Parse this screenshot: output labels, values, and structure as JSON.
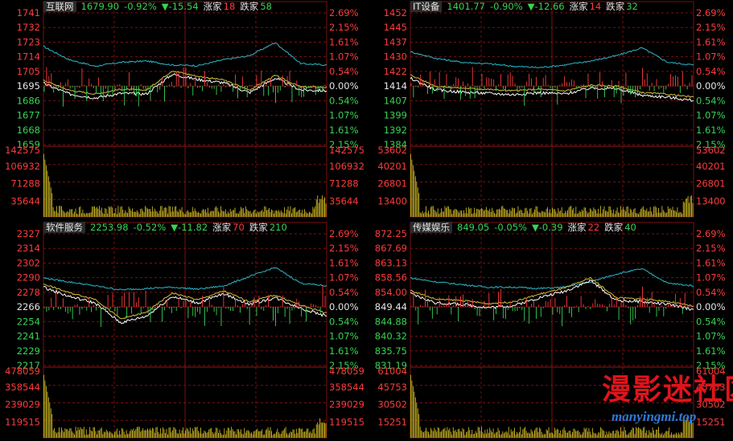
{
  "panels": [
    {
      "name": "互联网",
      "price": "1679.90",
      "pct_change": "-0.92%",
      "change": "▼-15.54",
      "up_label": "涨家",
      "up_count": "18",
      "down_label": "跌家",
      "down_count": "58",
      "price_ticks": [
        "1741",
        "1732",
        "1723",
        "1714",
        "1705",
        "1695",
        "1686",
        "1677",
        "1668",
        "1659"
      ],
      "pct_ticks": [
        "2.69%",
        "2.15%",
        "1.61%",
        "1.07%",
        "0.54%",
        "0.00%",
        "0.54%",
        "1.07%",
        "1.61%",
        "2.15%"
      ],
      "volume_ticks": [
        "142575",
        "106932",
        "71288",
        "35644"
      ]
    },
    {
      "name": "IT设备",
      "price": "1401.77",
      "pct_change": "-0.90%",
      "change": "▼-12.66",
      "up_label": "涨家",
      "up_count": "14",
      "down_label": "跌家",
      "down_count": "32",
      "price_ticks": [
        "1452",
        "1445",
        "1437",
        "1430",
        "1422",
        "1414",
        "1407",
        "1399",
        "1392",
        "1384"
      ],
      "pct_ticks": [
        "2.69%",
        "2.15%",
        "1.61%",
        "1.07%",
        "0.54%",
        "0.00%",
        "0.54%",
        "1.07%",
        "1.61%",
        "2.15%"
      ],
      "volume_ticks": [
        "53602",
        "40201",
        "26801",
        "13400"
      ]
    },
    {
      "name": "软件服务",
      "price": "2253.98",
      "pct_change": "-0.52%",
      "change": "▼-11.82",
      "up_label": "涨家",
      "up_count": "70",
      "down_label": "跌家",
      "down_count": "210",
      "price_ticks": [
        "2327",
        "2314",
        "2302",
        "2290",
        "2278",
        "2266",
        "2254",
        "2241",
        "2229",
        "2217"
      ],
      "pct_ticks": [
        "2.69%",
        "2.15%",
        "1.61%",
        "1.07%",
        "0.54%",
        "0.00%",
        "0.54%",
        "1.07%",
        "1.61%",
        "2.15%"
      ],
      "volume_ticks": [
        "478059",
        "358544",
        "239029",
        "119515"
      ]
    },
    {
      "name": "传媒娱乐",
      "price": "849.05",
      "pct_change": "-0.05%",
      "change": "▼-0.39",
      "up_label": "涨家",
      "up_count": "22",
      "down_label": "跌家",
      "down_count": "40",
      "price_ticks": [
        "872.25",
        "867.69",
        "863.13",
        "858.56",
        "854.00",
        "849.44",
        "844.88",
        "840.32",
        "835.75",
        "831.19"
      ],
      "pct_ticks": [
        "2.69%",
        "2.15%",
        "1.61%",
        "1.07%",
        "0.54%",
        "0.00%",
        "0.54%",
        "1.07%",
        "1.61%",
        "2.15%"
      ],
      "volume_ticks": [
        "61004",
        "45753",
        "30502",
        "15251"
      ]
    }
  ],
  "watermark": {
    "text": "漫影迷社区",
    "url": "manyingmi.top"
  },
  "colors": {
    "background": "#000000",
    "grid": "#7a1010",
    "price_up": "#ff3b3b",
    "price_down": "#39d353",
    "neutral": "#e6e6e6",
    "cyan_line": "#2fb6c8",
    "white_line": "#ffffff",
    "yellow_line": "#d8c13a",
    "volume": "#c9b521"
  }
}
